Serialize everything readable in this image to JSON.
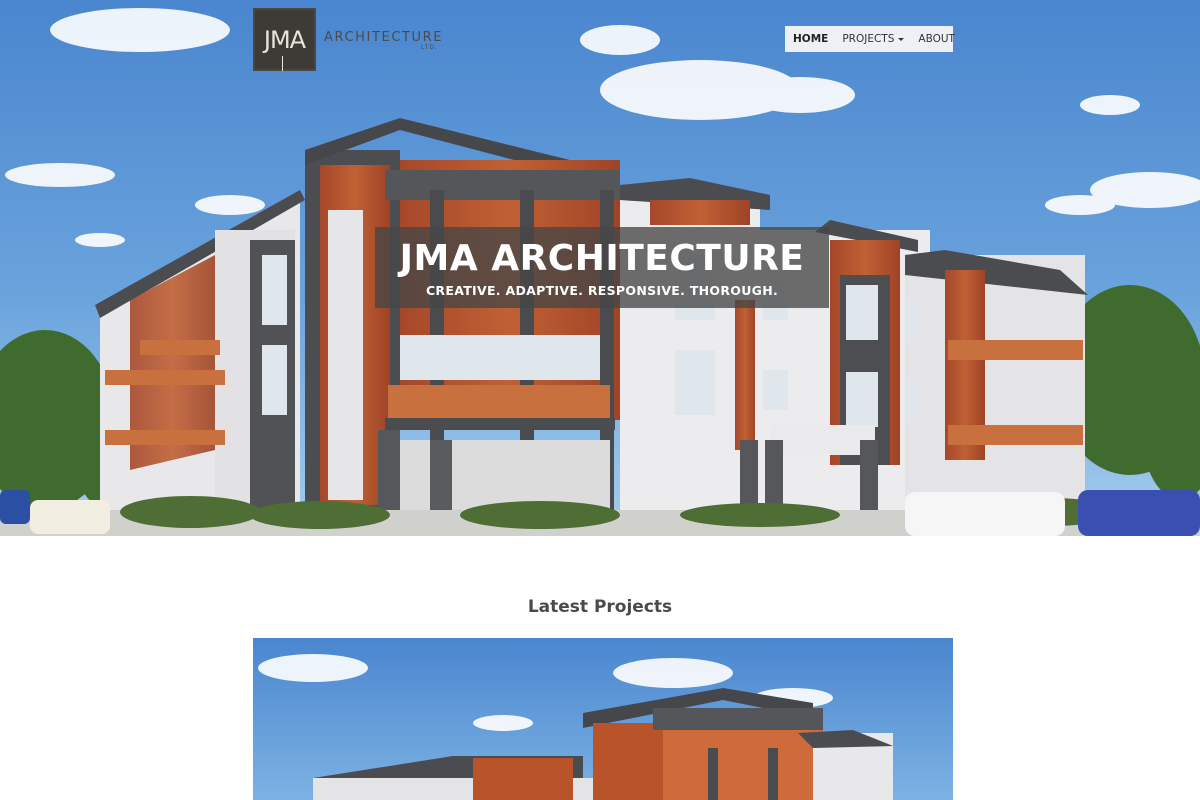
{
  "logo": {
    "monogram": "JMA",
    "wordmark": "ARCHITECTURE",
    "suffix": "LTD."
  },
  "nav": {
    "items": [
      {
        "label": "HOME",
        "active": true
      },
      {
        "label": "PROJECTS",
        "dropdown": true
      },
      {
        "label": "ABOUT"
      }
    ]
  },
  "hero": {
    "title": "JMA ARCHITECTURE",
    "tagline": "CREATIVE. ADAPTIVE. RESPONSIVE. THOROUGH."
  },
  "latest": {
    "heading": "Latest Projects"
  },
  "colors": {
    "sky_top": "#3f7fc9",
    "sky_bottom": "#8fbce6",
    "wood": "#b8532a",
    "panel": "#e9e9ea",
    "trim": "#4a4b4f",
    "banner_bg": "#464646"
  }
}
